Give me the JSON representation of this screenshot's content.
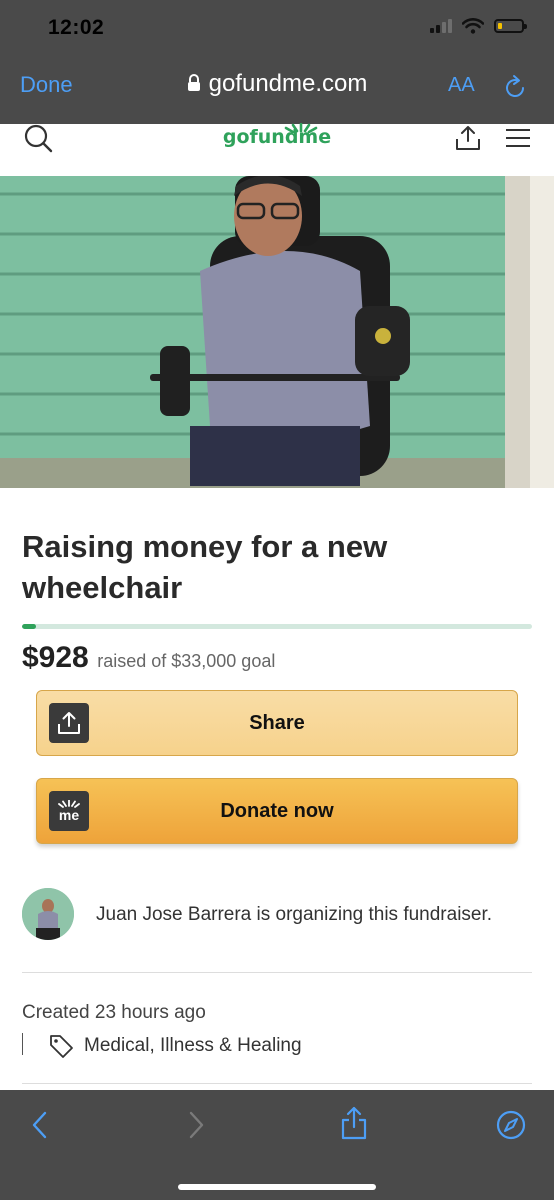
{
  "status_bar": {
    "time": "12:02"
  },
  "browser": {
    "done_label": "Done",
    "url": "gofundme.com",
    "text_size_label": "AA"
  },
  "site": {
    "logo_text": "gofundme"
  },
  "campaign": {
    "title": "Raising money for a new wheelchair",
    "raised": "$928",
    "goal_text": "raised of $33,000 goal",
    "progress_fraction": 0.028,
    "share_label": "Share",
    "donate_label": "Donate now",
    "donate_icon_text": "me",
    "organizer_text": "Juan Jose Barrera is organizing this fundraiser.",
    "created_text": "Created 23 hours ago",
    "category": "Medical, Illness & Healing"
  },
  "colors": {
    "brand_green": "#2fa25b",
    "safari_blue": "#4d9ef5",
    "donate_orange": "#eea33a",
    "share_tan": "#f6d28c"
  }
}
